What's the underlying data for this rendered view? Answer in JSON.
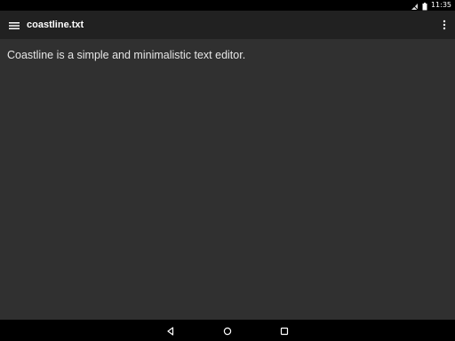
{
  "status_bar": {
    "time": "11:35",
    "icons": [
      "no-sim-icon",
      "battery-icon"
    ]
  },
  "app_bar": {
    "title": "coastline.txt",
    "left_icon": "menu-icon",
    "right_icon": "overflow-menu-icon"
  },
  "editor": {
    "content": "Coastline is a simple and minimalistic text editor."
  },
  "nav_bar": {
    "buttons": [
      "back-icon",
      "home-icon",
      "recents-icon"
    ]
  },
  "colors": {
    "status_bar_bg": "#000000",
    "app_bar_bg": "#212121",
    "editor_bg": "#303030",
    "text": "#e6e6e6",
    "nav_bar_bg": "#000000"
  }
}
